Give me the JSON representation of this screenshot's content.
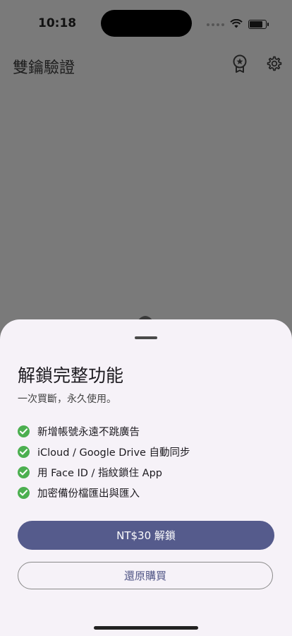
{
  "status_bar": {
    "time": "10:18",
    "battery_level": 0.9
  },
  "app_bar": {
    "title": "雙鑰驗證",
    "icons": [
      "award-icon",
      "gear-icon"
    ]
  },
  "sheet": {
    "title": "解鎖完整功能",
    "subtitle": "一次買斷，永久使用。",
    "features": [
      "新增帳號永遠不跳廣告",
      "iCloud / Google Drive 自動同步",
      "用 Face ID / 指紋鎖住 App",
      "加密備份檔匯出與匯入"
    ],
    "unlock_label": "NT$30 解鎖",
    "restore_label": "還原購買"
  },
  "colors": {
    "scrim": "#7a7a7a",
    "sheet_background": "#f6f2f8",
    "primary_button": "#555b8c",
    "check": "#4caf50"
  }
}
